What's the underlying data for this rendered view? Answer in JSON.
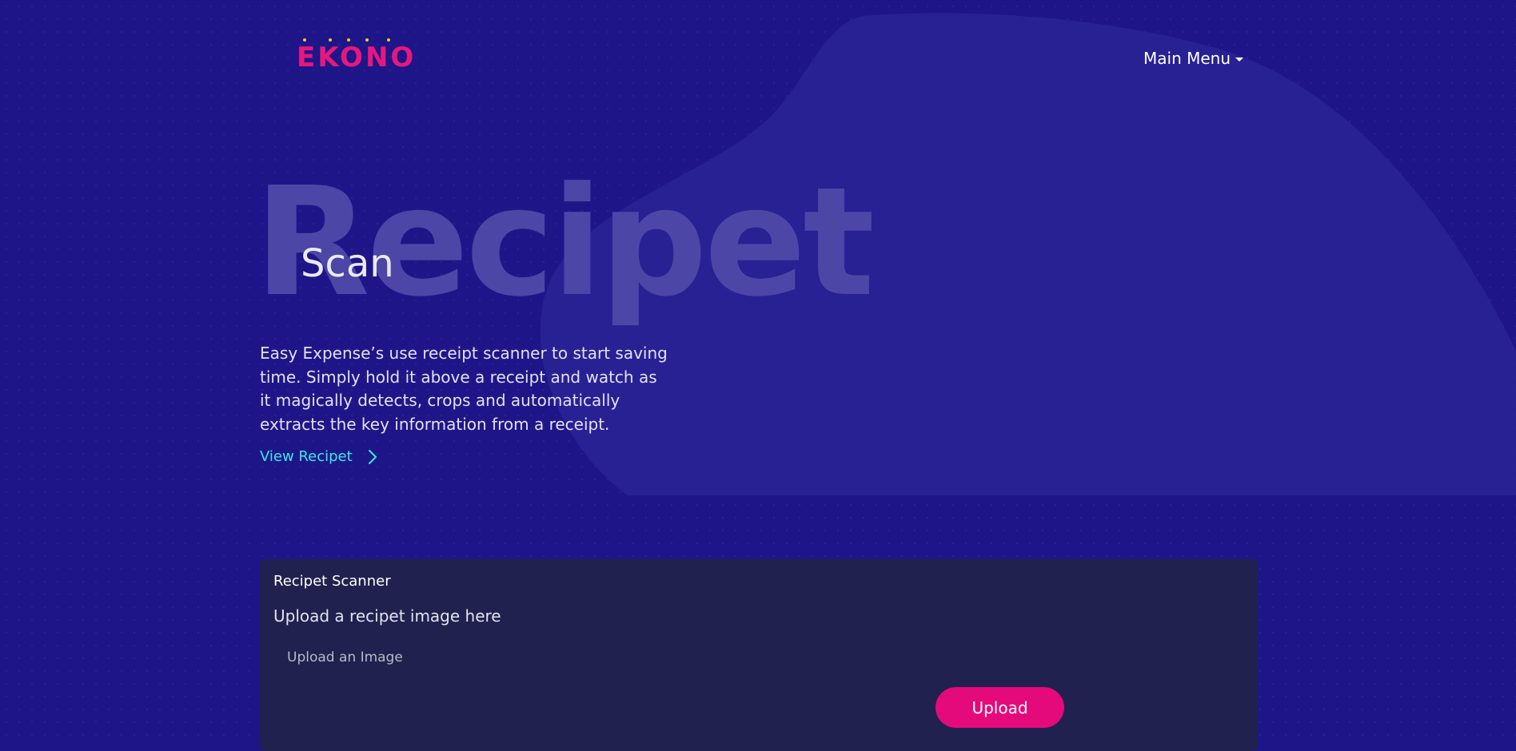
{
  "brand": {
    "logo_text": "EKONO",
    "logo_color": "#e6177e",
    "dot_color": "#f0c530"
  },
  "nav": {
    "main_menu_label": "Main Menu"
  },
  "hero": {
    "background_word": "Recipet",
    "title": "Scan",
    "description": "Easy Expense’s use receipt scanner to start saving time. Simply hold it above a receipt and watch as it magically detects, crops and automatically extracts the key information from a receipt.",
    "link_label": "View Recipet"
  },
  "scanner": {
    "title": "Recipet Scanner",
    "subtitle": "Upload a recipet image here",
    "upload_placeholder": "Upload an Image",
    "upload_button": "Upload"
  },
  "colors": {
    "background": "#1e1688",
    "panel": "#20214e",
    "accent": "#e50a7b",
    "link": "#3ee6e6"
  }
}
